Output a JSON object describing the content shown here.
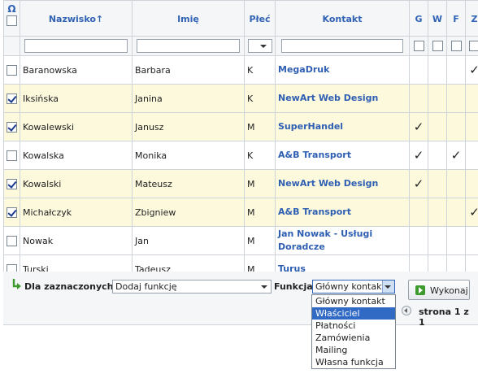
{
  "table": {
    "headers": {
      "omega": "Ω",
      "surname": "Nazwisko↑",
      "firstname": "Imię",
      "sex": "Płeć",
      "contact": "Kontakt",
      "g": "G",
      "w": "W",
      "f": "F",
      "z": "Z"
    },
    "check_mark": "✓",
    "rows": [
      {
        "surname": "Baranowska",
        "firstname": "Barbara",
        "sex": "K",
        "contact": "MegaDruk",
        "selected": false,
        "g": "",
        "w": "",
        "f": "",
        "z": "✓"
      },
      {
        "surname": "Iksińska",
        "firstname": "Janina",
        "sex": "K",
        "contact": "NewArt Web Design",
        "selected": true,
        "g": "",
        "w": "",
        "f": "",
        "z": ""
      },
      {
        "surname": "Kowalewski",
        "firstname": "Janusz",
        "sex": "M",
        "contact": "SuperHandel",
        "selected": true,
        "g": "✓",
        "w": "",
        "f": "",
        "z": ""
      },
      {
        "surname": "Kowalska",
        "firstname": "Monika",
        "sex": "K",
        "contact": "A&B Transport",
        "selected": false,
        "g": "✓",
        "w": "",
        "f": "✓",
        "z": ""
      },
      {
        "surname": "Kowalski",
        "firstname": "Mateusz",
        "sex": "M",
        "contact": "NewArt Web Design",
        "selected": true,
        "g": "✓",
        "w": "",
        "f": "",
        "z": ""
      },
      {
        "surname": "Michałczyk",
        "firstname": "Zbigniew",
        "sex": "M",
        "contact": "A&B Transport",
        "selected": true,
        "g": "",
        "w": "",
        "f": "",
        "z": "✓"
      },
      {
        "surname": "Nowak",
        "firstname": "Jan",
        "sex": "M",
        "contact": "Jan Nowak - Usługi Doradcze",
        "selected": false,
        "g": "",
        "w": "",
        "f": "",
        "z": ""
      },
      {
        "surname": "Turski",
        "firstname": "Tadeusz",
        "sex": "M",
        "contact": "Turus",
        "selected": false,
        "g": "",
        "w": "",
        "f": "",
        "z": ""
      }
    ]
  },
  "footer": {
    "for_selected_label": "Dla zaznaczonych:",
    "action_value": "Dodaj funkcję",
    "function_label": "Funkcja:",
    "function_value": "Główny kontakt",
    "execute_label": "Wykonaj",
    "pager_text": "strona 1 z 1"
  },
  "dropdown": {
    "options": [
      "Główny kontakt",
      "Właściciel",
      "Płatności",
      "Zamówienia",
      "Mailing",
      "Własna funkcja"
    ],
    "highlighted_index": 1
  },
  "colors": {
    "accent": "#3163b4",
    "selected_row": "#fcf9dd",
    "highlight": "#316ac5"
  }
}
